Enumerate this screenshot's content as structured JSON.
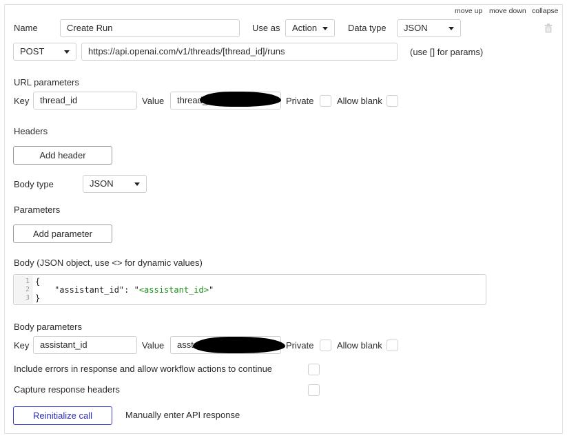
{
  "toolbar": {
    "move_up": "move up",
    "move_down": "move down",
    "collapse": "collapse"
  },
  "call": {
    "name_label": "Name",
    "name_value": "Create Run",
    "use_as_label": "Use as",
    "use_as_value": "Action",
    "data_type_label": "Data type",
    "data_type_value": "JSON",
    "method_value": "POST",
    "url_value": "https://api.openai.com/v1/threads/[thread_id]/runs",
    "url_hint": "(use [] for params)"
  },
  "url_params": {
    "heading": "URL parameters",
    "key_label": "Key",
    "key_value": "thread_id",
    "value_label": "Value",
    "value_prefix": "thread_",
    "private_label": "Private",
    "allow_blank_label": "Allow blank"
  },
  "headers": {
    "heading": "Headers",
    "add_label": "Add header"
  },
  "body_type": {
    "label": "Body type",
    "value": "JSON"
  },
  "parameters": {
    "heading": "Parameters",
    "add_label": "Add parameter"
  },
  "body": {
    "heading": "Body (JSON object, use <> for dynamic values)",
    "line_numbers": [
      "1",
      "2",
      "3"
    ],
    "line1": "{",
    "line2_key": "\"assistant_id\": \"",
    "line2_dynamic": "<assistant_id>",
    "line2_end": "\"",
    "line3": "}"
  },
  "body_params": {
    "heading": "Body parameters",
    "key_label": "Key",
    "key_value": "assistant_id",
    "value_label": "Value",
    "value_prefix": "asst",
    "private_label": "Private",
    "allow_blank_label": "Allow blank"
  },
  "options": {
    "include_errors_label": "Include errors in response and allow workflow actions to continue",
    "capture_headers_label": "Capture response headers"
  },
  "footer": {
    "reinitialize_label": "Reinitialize call",
    "manual_label": "Manually enter API response"
  },
  "icons": {
    "delete": "trash-icon",
    "dropdown": "chevron-down-icon"
  }
}
